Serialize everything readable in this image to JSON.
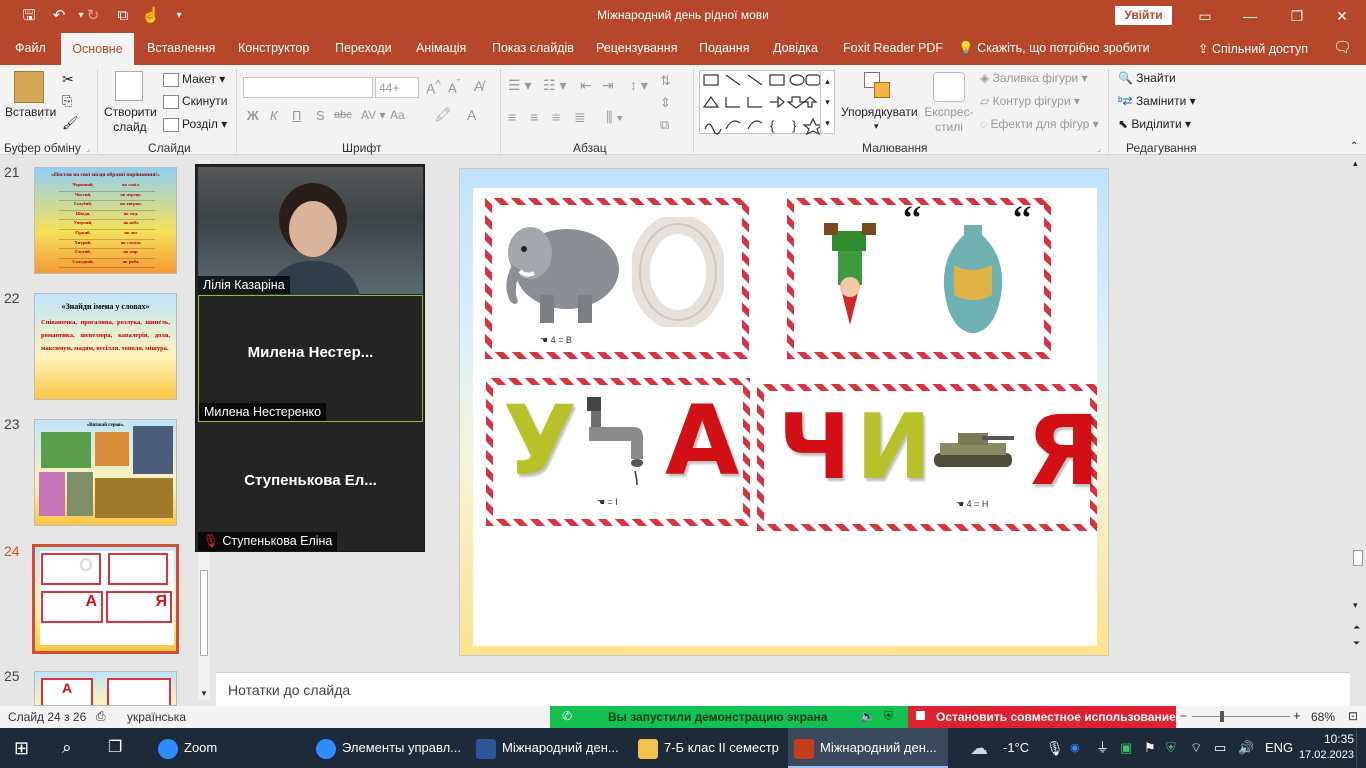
{
  "titlebar": {
    "doc_title": "Міжнародний день рідної мови",
    "signin": "Увійти",
    "minimize": "—",
    "restore": "❐",
    "close": "✕"
  },
  "tabs": [
    {
      "label": "Файл"
    },
    {
      "label": "Основне"
    },
    {
      "label": "Вставлення"
    },
    {
      "label": "Конструктор"
    },
    {
      "label": "Переходи"
    },
    {
      "label": "Анімація"
    },
    {
      "label": "Показ слайдів"
    },
    {
      "label": "Рецензування"
    },
    {
      "label": "Подання"
    },
    {
      "label": "Довідка"
    },
    {
      "label": "Foxit Reader PDF"
    }
  ],
  "tell_me": "Скажіть, що потрібно зробити",
  "share": "Спільний доступ",
  "ribbon": {
    "clipboard": {
      "paste": "Вставити",
      "group": "Буфер обміну"
    },
    "slides": {
      "new_slide": "Створити слайд",
      "layout": "Макет",
      "reset": "Скинути",
      "section": "Розділ",
      "group": "Слайди"
    },
    "font": {
      "size": "44+",
      "group": "Шрифт",
      "bold": "Ж",
      "italic": "К",
      "underline": "П",
      "strike": "S",
      "spacing": "abc",
      "case": "Aa",
      "color": "A"
    },
    "paragraph": {
      "group": "Абзац"
    },
    "drawing": {
      "arrange": "Упорядкувати",
      "quick_styles": "Експрес-стилі",
      "fill": "Заливка фігури",
      "outline": "Контур фігури",
      "effects": "Ефекти для фігур",
      "group": "Малювання"
    },
    "editing": {
      "find": "Знайти",
      "replace": "Замінити",
      "select": "Виділити",
      "group": "Редагування"
    }
  },
  "thumbnails": [
    {
      "num": "21",
      "title": "«Постав на свої місця образні порівняння!»",
      "rows": [
        [
          "Червоний,",
          "як сокіл."
        ],
        [
          "Чистий,",
          "як перець."
        ],
        [
          "Голубий,",
          "як тигрик."
        ],
        [
          "Шкідя,",
          "як мед."
        ],
        [
          "Упертий,",
          "як небо"
        ],
        [
          "Гіркий,",
          "як лис"
        ],
        [
          "Хитрий,",
          "як сльоза."
        ],
        [
          "Глухий,",
          "як жар."
        ],
        [
          "Солодкий,",
          "як риба."
        ]
      ]
    },
    {
      "num": "22",
      "title": "«Знайди імена у словах»",
      "body": "Співаночка, прогалина, розлука, шинель, романтика, шевелюра, кавалерія, доля, максимум, мадям, весілля, тополя, мішура."
    },
    {
      "num": "23",
      "title": "«Впізнай героя»."
    },
    {
      "num": "24",
      "selected": true
    },
    {
      "num": "25"
    }
  ],
  "zoom": {
    "participants": [
      {
        "name": "Лілія Казаріна"
      },
      {
        "big": "Милена  Нестер...",
        "name": "Милена Нестеренко"
      },
      {
        "big": "Ступенькова  Ел...",
        "name": "Ступенькова Еліна",
        "muted_icon": "muted-mic-icon"
      }
    ]
  },
  "slide": {
    "letters": {
      "o": "О",
      "u": "У",
      "a": "А",
      "ch": "Ч",
      "i": "И",
      "ya": "Я"
    },
    "hints": {
      "h1": "4  = В",
      "h2": "= І",
      "h3": "4 = Н"
    }
  },
  "notes_placeholder": "Нотатки до слайда",
  "status": {
    "slide": "Слайд 24 з 26",
    "lang": "українська",
    "sharing": "Вы запустили демонстрацию экрана",
    "stop_share": "Остановить совместное использование",
    "zoom": "68%"
  },
  "taskbar": {
    "apps": [
      {
        "label": "Zoom"
      },
      {
        "label": "Элементы управл..."
      },
      {
        "label": "Міжнародний ден..."
      },
      {
        "label": "7-Б клас ІІ семестр"
      },
      {
        "label": "Міжнародний ден..."
      }
    ],
    "weather": "-1°C",
    "lang": "ENG",
    "time": "10:35",
    "date": "17.02.2023"
  },
  "colors": {
    "accent": "#b7472a",
    "share_green": "#12c151",
    "stop_red": "#e0212f",
    "selected_thumb": "#d2502e"
  }
}
